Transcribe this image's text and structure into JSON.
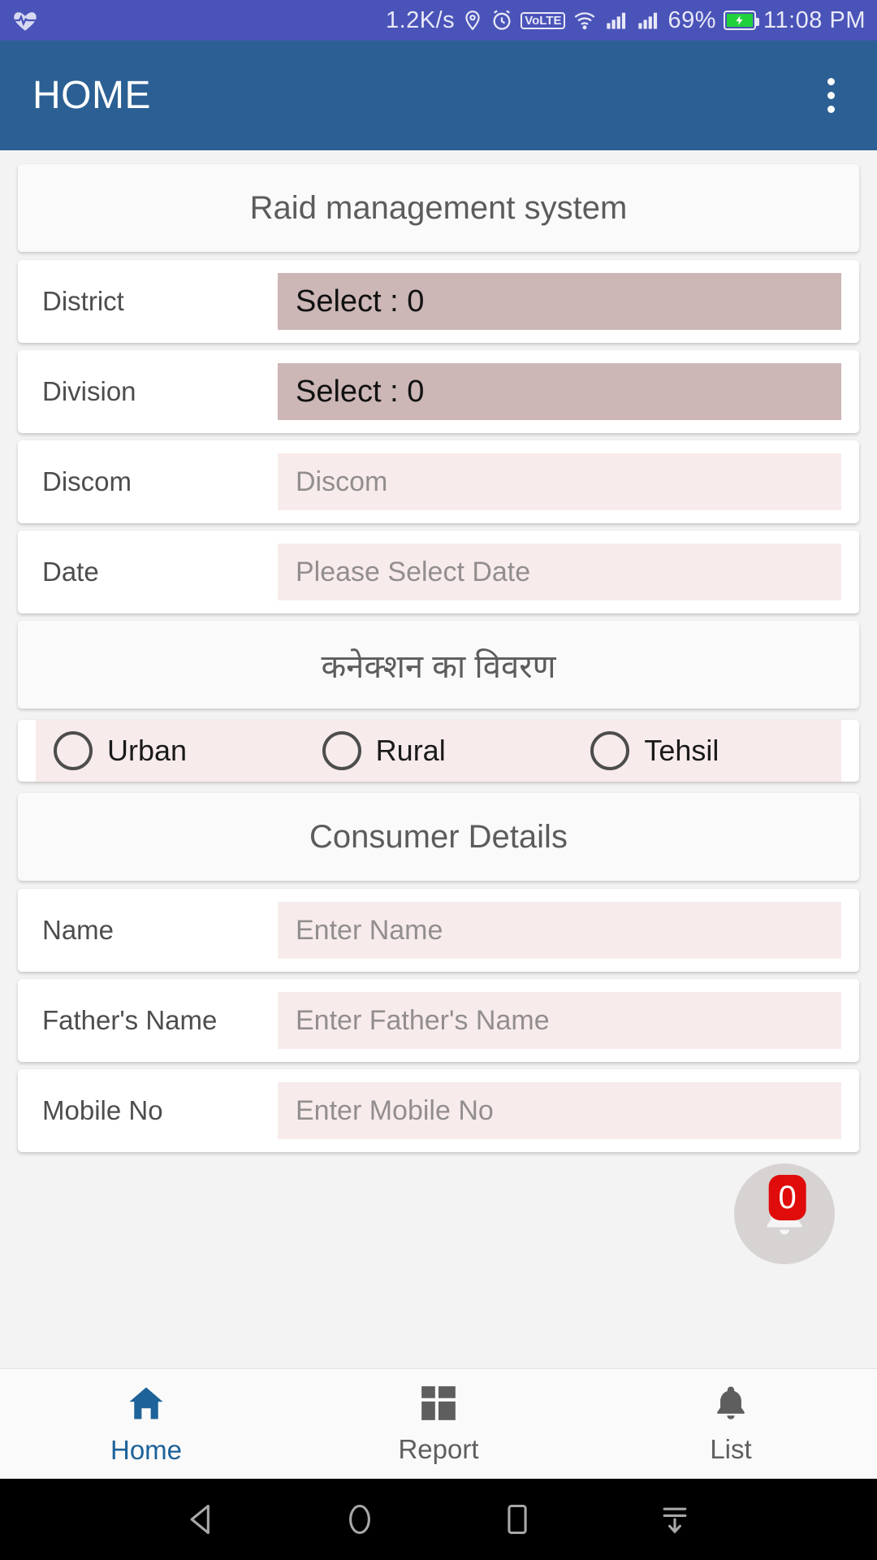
{
  "status_bar": {
    "app_icon": "heart-rate-icon",
    "network_speed": "1.2K/s",
    "icons": [
      "location-pin-icon",
      "alarm-clock-icon",
      "volte-icon",
      "wifi-icon",
      "signal-bars-icon",
      "signal-bars-icon"
    ],
    "volte_label": "VoLTE",
    "battery_percent": "69%",
    "battery_state": "charging",
    "time": "11:08 PM",
    "background_color": "#4a53b8"
  },
  "app_bar": {
    "title": "HOME",
    "overflow_menu": "more-options",
    "background_color": "#2c6094"
  },
  "form": {
    "heading": "Raid management system",
    "rows": [
      {
        "label": "District",
        "value": "Select : 0",
        "placeholder": "",
        "style": "filled"
      },
      {
        "label": "Division",
        "value": "Select : 0",
        "placeholder": "",
        "style": "filled"
      },
      {
        "label": "Discom",
        "value": "",
        "placeholder": "Discom",
        "style": "empty"
      },
      {
        "label": "Date",
        "value": "",
        "placeholder": "Please Select Date",
        "style": "empty"
      }
    ],
    "connection_section": {
      "heading": "कनेक्शन का विवरण",
      "options": [
        {
          "label": "Urban",
          "selected": false
        },
        {
          "label": "Rural",
          "selected": false
        },
        {
          "label": "Tehsil",
          "selected": false
        }
      ]
    },
    "consumer_section": {
      "heading": "Consumer Details",
      "rows": [
        {
          "label": "Name",
          "value": "",
          "placeholder": "Enter Name"
        },
        {
          "label": "Father's Name",
          "value": "",
          "placeholder": "Enter Father's Name"
        },
        {
          "label": "Mobile No",
          "value": "",
          "placeholder": "Enter Mobile No"
        }
      ]
    }
  },
  "floating_button": {
    "icon": "bell-icon",
    "badge_count": "0",
    "badge_color": "#e00c0c"
  },
  "bottom_nav": {
    "items": [
      {
        "label": "Home",
        "icon": "home-icon",
        "active": true
      },
      {
        "label": "Report",
        "icon": "dashboard-icon",
        "active": false
      },
      {
        "label": "List",
        "icon": "bell-icon",
        "active": false
      }
    ],
    "active_color": "#1d6299"
  },
  "android_nav": {
    "buttons": [
      "back-icon",
      "home-circle-icon",
      "recents-square-icon",
      "hide-keyboard-icon"
    ]
  },
  "colors": {
    "field_filled": "#ccb6b6",
    "field_empty": "#f7eceb",
    "page_background": "#f4f3f3"
  }
}
